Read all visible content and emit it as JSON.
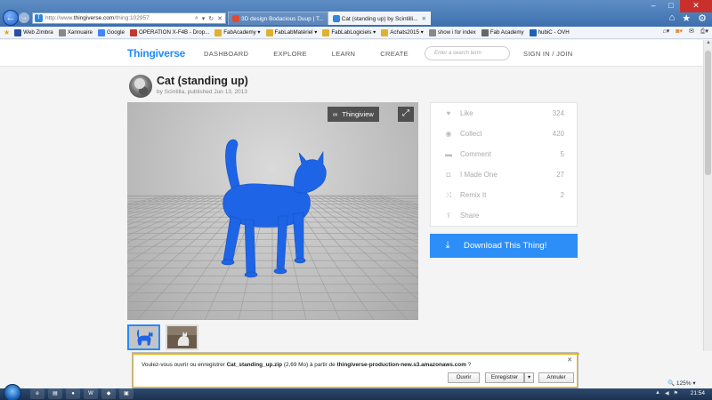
{
  "browser": {
    "url_prefix": "http://www.",
    "url_domain": "thingiverse.com",
    "url_path": "/thing:102957",
    "tabs": [
      {
        "label": "3D design Bodacious Duup | T...",
        "active": false,
        "icon": "tinkercad-icon",
        "color": "#e24a33"
      },
      {
        "label": "Cat (standing up) by Scintilli...",
        "active": true,
        "icon": "thingiverse-icon",
        "color": "#2e86de"
      }
    ],
    "favorites": [
      {
        "label": "Web Zimbra",
        "icon": "zimbra-icon",
        "color": "#2b4f9e"
      },
      {
        "label": "Xannuaire",
        "icon": "page-icon",
        "color": "#888"
      },
      {
        "label": "Google",
        "icon": "google-icon",
        "color": "#4285f4"
      },
      {
        "label": "OPERATION X-F4B - Drop...",
        "icon": "dropbox-icon",
        "color": "#c0392b"
      },
      {
        "label": "FabAcademy ▾",
        "icon": "folder-icon",
        "color": "#e0b030"
      },
      {
        "label": "FabLabMatériel ▾",
        "icon": "folder-icon",
        "color": "#e0b030"
      },
      {
        "label": "FabLabLogiciels ▾",
        "icon": "folder-icon",
        "color": "#e0b030"
      },
      {
        "label": "Achats2015 ▾",
        "icon": "folder-icon",
        "color": "#e0b030"
      },
      {
        "label": "show i for index",
        "icon": "page-icon",
        "color": "#888"
      },
      {
        "label": "Fab Academy",
        "icon": "fab-icon",
        "color": "#666"
      },
      {
        "label": "hubiC - OVH",
        "icon": "hubic-icon",
        "color": "#1d62b5"
      }
    ]
  },
  "site": {
    "logo": "Thingiverse",
    "nav": [
      "DASHBOARD",
      "EXPLORE",
      "LEARN",
      "CREATE"
    ],
    "search_placeholder": "Enter a search term",
    "signin": "SIGN IN / JOIN"
  },
  "thing": {
    "title": "Cat (standing up)",
    "byline": "by Scintilla, published Jun 13, 2013",
    "viewer_button": "Thingiview",
    "actions": [
      {
        "label": "Like",
        "count": "324",
        "icon": "heart-icon"
      },
      {
        "label": "Collect",
        "count": "420",
        "icon": "collect-icon"
      },
      {
        "label": "Comment",
        "count": "5",
        "icon": "comment-icon"
      },
      {
        "label": "I Made One",
        "count": "27",
        "icon": "camera-icon"
      },
      {
        "label": "Remix It",
        "count": "2",
        "icon": "remix-icon"
      },
      {
        "label": "Share",
        "count": "",
        "icon": "share-icon"
      }
    ],
    "download_label": "Download This Thing!"
  },
  "download_bar": {
    "prefix": "Voulez-vous ouvrir ou enregistrer ",
    "filename": "Cat_standing_up.zip",
    "size": " (2,69 Mo) à partir de ",
    "host": "thingiverse-production-new.s3.amazonaws.com",
    "suffix": " ?",
    "open": "Ouvrir",
    "save": "Enregistrer",
    "cancel": "Annuler"
  },
  "status": {
    "zoom": "125%",
    "clock": "21:54"
  },
  "colors": {
    "brand_blue": "#248bfb",
    "download_blue": "#2d8ef7",
    "model_blue": "#1e64e6"
  }
}
